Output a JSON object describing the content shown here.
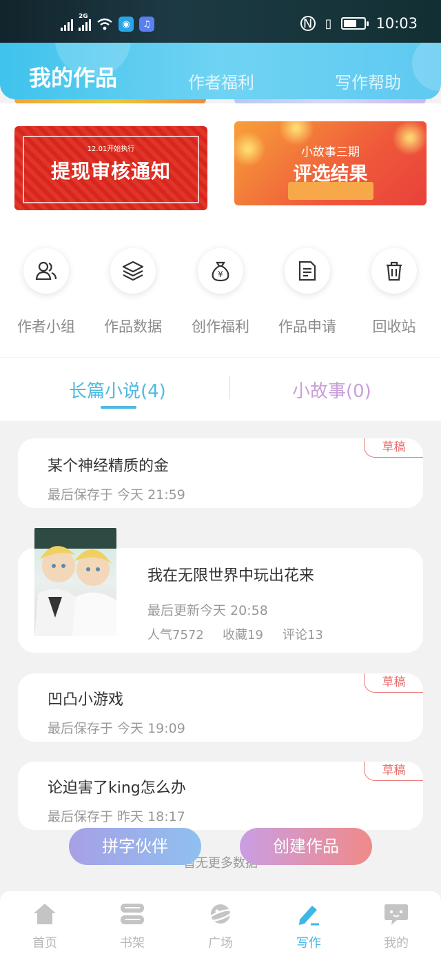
{
  "status": {
    "time": "10:03",
    "network": "2G"
  },
  "header": {
    "title": "我的作品",
    "tabs": [
      "作者福利",
      "写作帮助"
    ]
  },
  "banners": {
    "left": {
      "small": "12.01开始执行",
      "big": "提现审核通知"
    },
    "right": {
      "line1": "小故事三期",
      "line2": "评选结果"
    }
  },
  "quick_actions": [
    {
      "label": "作者小组",
      "icon": "group-icon"
    },
    {
      "label": "作品数据",
      "icon": "layers-icon"
    },
    {
      "label": "创作福利",
      "icon": "money-bag-icon"
    },
    {
      "label": "作品申请",
      "icon": "document-icon"
    },
    {
      "label": "回收站",
      "icon": "trash-icon"
    }
  ],
  "novel_tabs": {
    "long": "长篇小说(4)",
    "short": "小故事(0)"
  },
  "works": [
    {
      "title": "某个神经精质的金",
      "meta": "最后保存于 今天 21:59",
      "badge": "草稿"
    },
    {
      "title": "我在无限世界中玩出花来",
      "meta": "最后更新今天 20:58",
      "popularity": "人气7572",
      "favorites": "收藏19",
      "comments": "评论13"
    },
    {
      "title": "凹凸小游戏",
      "meta": "最后保存于 今天 19:09",
      "badge": "草稿"
    },
    {
      "title": "论迫害了king怎么办",
      "meta": "最后保存于 昨天 18:17",
      "badge": "草稿"
    }
  ],
  "footer": {
    "no_more": "暂无更多数据",
    "partner_button": "拼字伙伴",
    "create_button": "创建作品"
  },
  "bottom_nav": [
    {
      "label": "首页",
      "icon": "home-icon"
    },
    {
      "label": "书架",
      "icon": "bookshelf-icon"
    },
    {
      "label": "广场",
      "icon": "planet-icon"
    },
    {
      "label": "写作",
      "icon": "pen-icon"
    },
    {
      "label": "我的",
      "icon": "chat-bubble-icon"
    }
  ],
  "colors": {
    "accent": "#3fc3ec",
    "draft": "#e8706e",
    "active_nav": "#3fb6e4"
  }
}
